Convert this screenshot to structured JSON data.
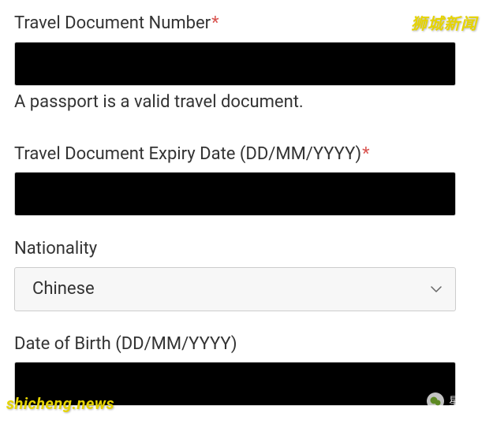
{
  "form": {
    "travelDocNumber": {
      "label": "Travel Document Number",
      "value": "",
      "help": "A passport is a valid travel document."
    },
    "travelDocExpiry": {
      "label": "Travel Document Expiry Date (DD/MM/YYYY)",
      "value": ""
    },
    "nationality": {
      "label": "Nationality",
      "selected": "Chinese"
    },
    "dateOfBirth": {
      "label": "Date of Birth (DD/MM/YYYY)",
      "value": ""
    },
    "requiredMark": "*"
  },
  "watermarks": {
    "topRight": "狮城新闻",
    "bottomLeft": "shicheng.news",
    "bottomRight": "星传媒"
  }
}
